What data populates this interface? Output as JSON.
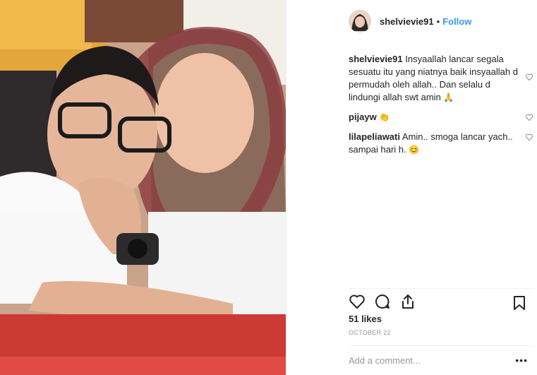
{
  "post": {
    "username": "shelvievie91",
    "follow_label": "Follow",
    "separator": "•"
  },
  "comments": [
    {
      "user": "shelvievie91",
      "text": "Insyaallah lancar segala sesuatu itu yang niatnya baik insyaallah d permudah oleh allah.. Dan selalu d lindungi allah swt amin",
      "emoji": "🙏"
    },
    {
      "user": "pijayw",
      "text": "",
      "emoji": "👏"
    },
    {
      "user": "lilapeliawati",
      "text": "Amin.. smoga lancar yach.. sampai hari h.",
      "emoji": "😊"
    }
  ],
  "engagement": {
    "likes": "51 likes",
    "date": "OCTOBER 22"
  },
  "add_comment": {
    "placeholder": "Add a comment...",
    "more_label": "•••"
  },
  "icons": {
    "like": "heart-icon",
    "comment": "comment-icon",
    "share": "share-icon",
    "save": "bookmark-icon"
  }
}
